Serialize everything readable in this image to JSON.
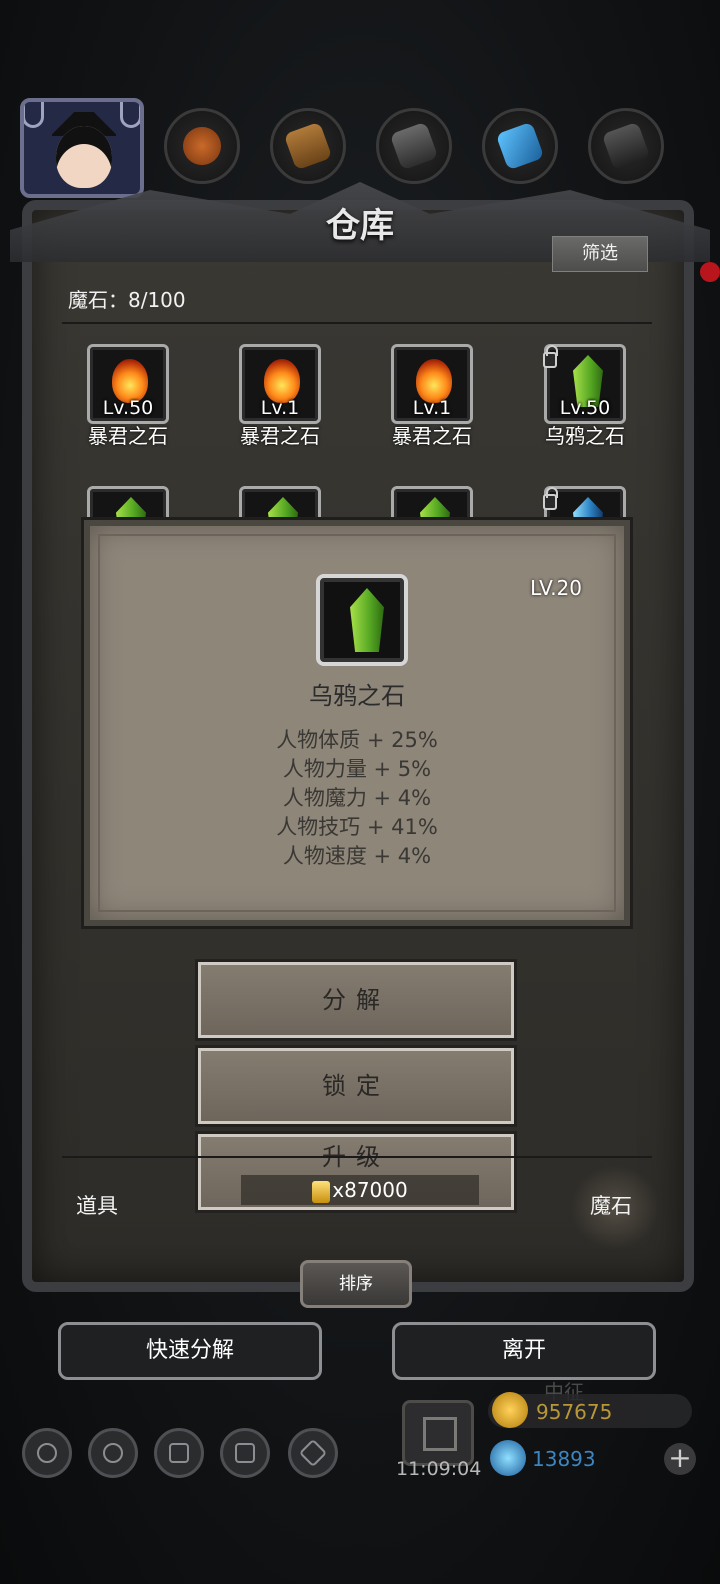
{
  "window": {
    "title": "仓库"
  },
  "filter_label": "筛选",
  "capacity": {
    "label": "魔石：8/100"
  },
  "items": [
    {
      "level": "Lv.50",
      "name": "暴君之石",
      "kind": "fire",
      "locked": false
    },
    {
      "level": "Lv.1",
      "name": "暴君之石",
      "kind": "fire",
      "locked": false
    },
    {
      "level": "Lv.1",
      "name": "暴君之石",
      "kind": "fire",
      "locked": false
    },
    {
      "level": "Lv.50",
      "name": "乌鸦之石",
      "kind": "green",
      "locked": true
    },
    {
      "kind": "green",
      "locked": false
    },
    {
      "kind": "green",
      "locked": false
    },
    {
      "kind": "green",
      "locked": false
    },
    {
      "kind": "blue",
      "locked": true
    }
  ],
  "detail": {
    "level": "LV.20",
    "name": "乌鸦之石",
    "icon": "green-crystal-icon",
    "stats": [
      "人物体质 + 25%",
      "人物力量 + 5%",
      "人物魔力 + 4%",
      "人物技巧 + 41%",
      "人物速度 + 4%"
    ]
  },
  "actions": {
    "decompose": "分解",
    "lock": "锁定",
    "upgrade": "升级",
    "upgrade_cost": "x87000"
  },
  "tabs": [
    {
      "label": "道具",
      "active": false
    },
    {
      "label": "魔石",
      "active": true
    }
  ],
  "sort_label": "排序",
  "quick_decompose": "快速分解",
  "leave": "离开",
  "hud": {
    "timer": "11:09:04",
    "gold": "957675",
    "gems": "13893",
    "behind_label": "中征",
    "colors": {
      "gold": "#b89836",
      "gem": "#3e86c0"
    }
  }
}
